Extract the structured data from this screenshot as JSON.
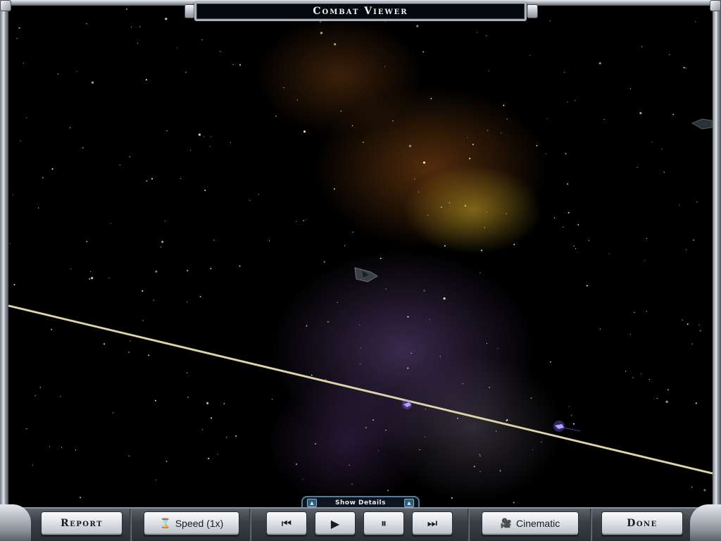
{
  "window": {
    "title": "Combat Viewer"
  },
  "details_tab": {
    "label": "Show Details",
    "left_arrow": "▲",
    "right_arrow": "▲"
  },
  "toolbar": {
    "report_label": "Report",
    "speed_label": "Speed (1x)",
    "speed_icon": "hourglass-icon",
    "skip_back_icon": "⏮",
    "play_icon": "▶",
    "pause_icon": "⏸",
    "skip_forward_icon": "⏭",
    "cinematic_label": "Cinematic",
    "cinematic_icon": "movie-camera-icon",
    "done_label": "Done"
  },
  "scene": {
    "background_color": "#000000",
    "beam_color": "#d8cfa0",
    "ship_glow_color": "#8a6cff"
  }
}
